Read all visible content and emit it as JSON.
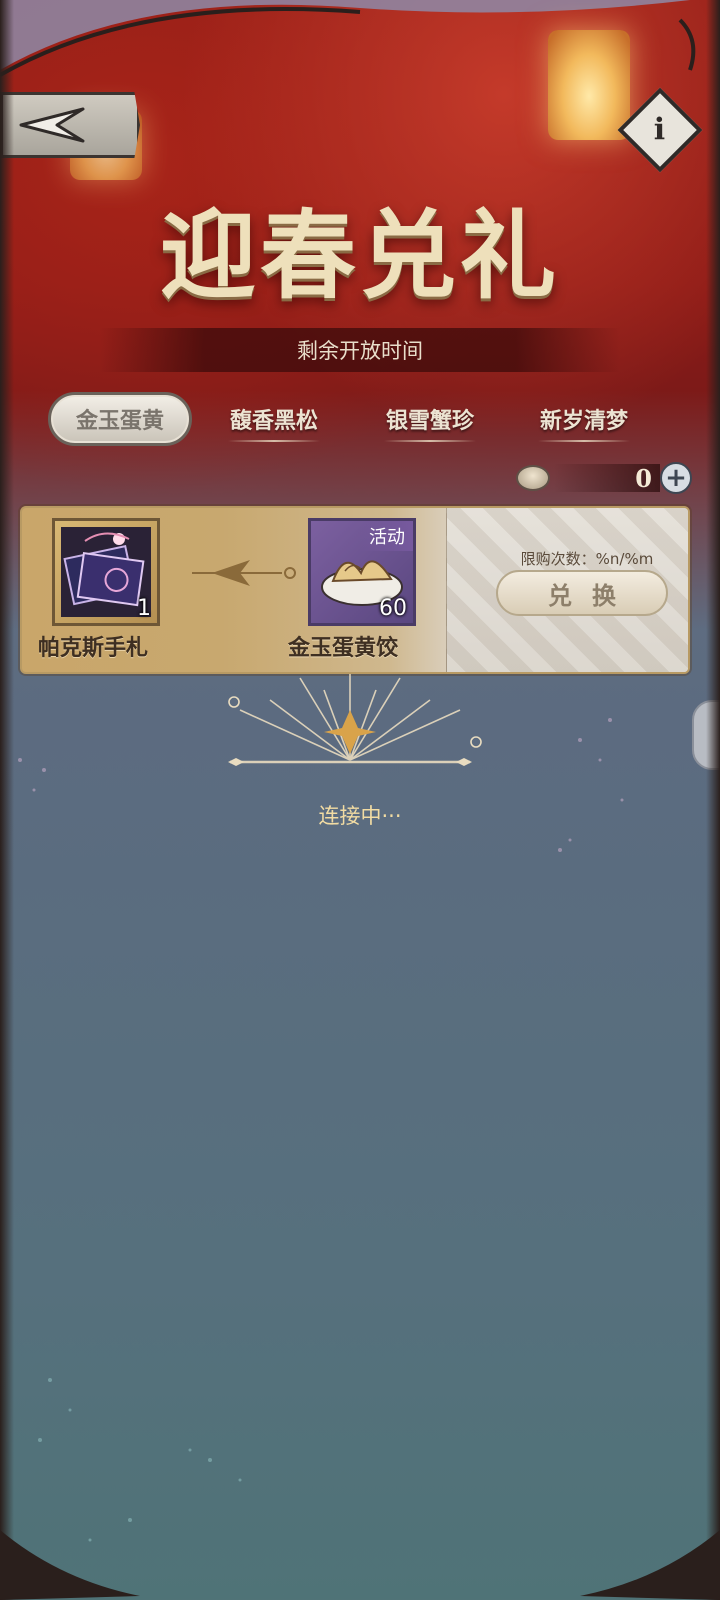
{
  "header": {
    "title": "迎春兑礼",
    "timer_label": "剩余开放时间"
  },
  "buttons": {
    "back_icon": "back-arrow-icon",
    "info_label": "i"
  },
  "tabs": [
    {
      "label": "金玉蛋黄",
      "active": true
    },
    {
      "label": "馥香黑松",
      "active": false
    },
    {
      "label": "银雪蟹珍",
      "active": false
    },
    {
      "label": "新岁清梦",
      "active": false
    }
  ],
  "currency": {
    "icon": "dumpling-coin-icon",
    "count": "0",
    "add_icon": "plus-icon"
  },
  "exchange_card": {
    "from_item": {
      "name": "帕克斯手札",
      "qty": "1",
      "icon": "letters-icon"
    },
    "to_item": {
      "name": "金玉蛋黄饺",
      "qty": "60",
      "tag": "活动",
      "icon": "dumpling-plate-icon"
    },
    "limit_text": "限购次数：%n/%m",
    "exchange_label": "兑换"
  },
  "status": {
    "loading_text": "连接中···"
  },
  "colors": {
    "header_red": "#8b1a16",
    "gold": "#c9a66a",
    "body_blue": "#5c6b80",
    "loading_text": "#f2dca3"
  }
}
